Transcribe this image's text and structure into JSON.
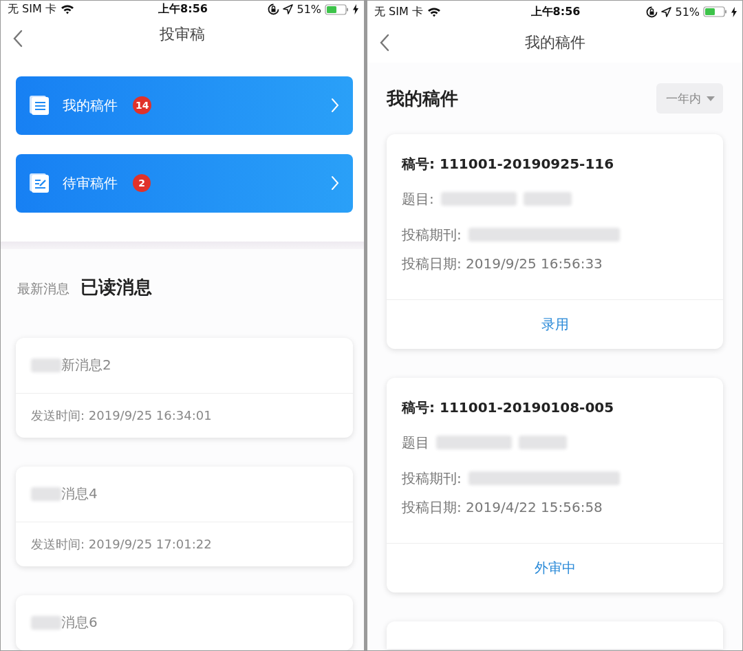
{
  "phones": [
    {
      "status_bar": {
        "carrier": "无 SIM 卡",
        "time": "上午8:56",
        "battery": "51%"
      },
      "nav": {
        "title": "投审稿"
      },
      "entries": [
        {
          "kind": "list",
          "label": "我的稿件",
          "badge": "14"
        },
        {
          "kind": "edit",
          "label": "待审稿件",
          "badge": "2"
        }
      ],
      "tabs": [
        {
          "label": "最新消息",
          "selected": false
        },
        {
          "label": "已读消息",
          "selected": true
        }
      ],
      "messages": [
        {
          "redacted": true,
          "title": "新消息2",
          "time": "发送时间: 2019/9/25 16:34:01"
        },
        {
          "redacted": true,
          "title": "消息4",
          "time": "发送时间: 2019/9/25 17:01:22"
        },
        {
          "redacted": true,
          "title": "消息6"
        }
      ]
    },
    {
      "status_bar": {
        "carrier": "无 SIM 卡",
        "time": "上午8:56",
        "battery": "51%"
      },
      "nav": {
        "title": "我的稿件"
      },
      "heading": "我的稿件",
      "filter": "一年内",
      "manuscripts": [
        {
          "number": "稿号: 111001-20190925-116",
          "title_label": "题目:",
          "journal_label": "投稿期刊:",
          "redacted": true,
          "date": "投稿日期: 2019/9/25 16:56:33",
          "status": "录用"
        },
        {
          "number": "稿号: 111001-20190108-005",
          "title_label": "题目",
          "journal_label": "投稿期刊:",
          "redacted": true,
          "date": "投稿日期: 2019/4/22 15:56:58",
          "status": "外审中"
        }
      ]
    }
  ]
}
